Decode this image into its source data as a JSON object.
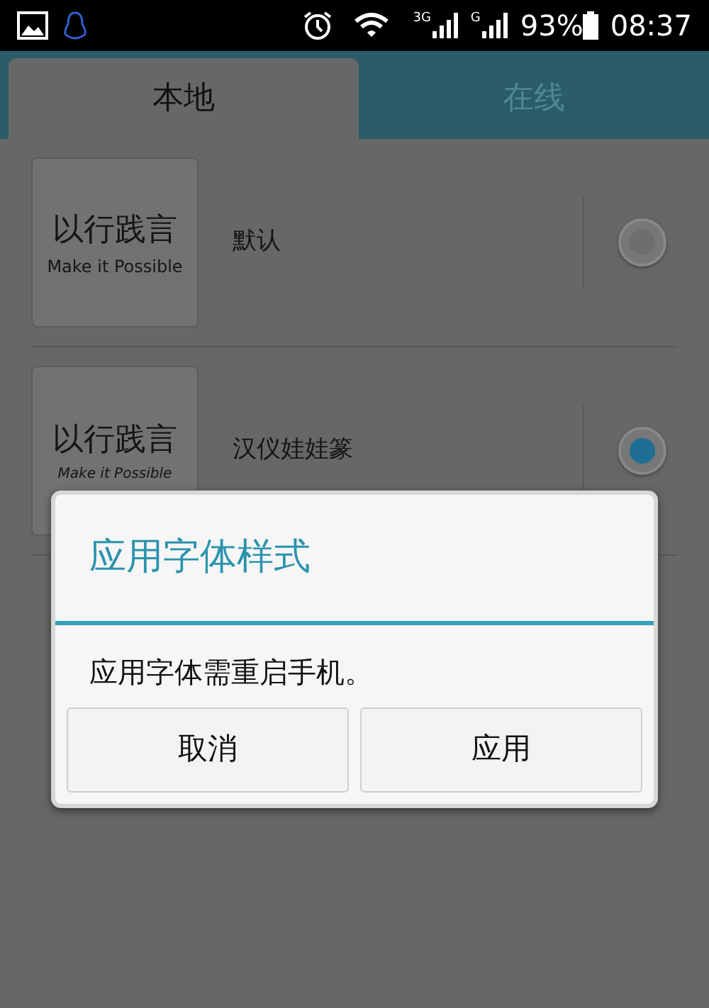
{
  "status_bar": {
    "network_3g": "3G",
    "network_g": "G",
    "battery": "93%",
    "time": "08:37"
  },
  "tabs": [
    {
      "label": "本地",
      "selected": true
    },
    {
      "label": "在线",
      "selected": false
    }
  ],
  "fonts": [
    {
      "preview_title": "以行践言",
      "preview_subtitle": "Make it Possible",
      "name": "默认",
      "selected": false,
      "kind": "plain"
    },
    {
      "preview_title": "以行践言",
      "preview_subtitle": "Make it Possible",
      "name": "汉仪娃娃篆",
      "selected": true,
      "kind": "handwritten"
    }
  ],
  "dialog": {
    "title": "应用字体样式",
    "message": "应用字体需重启手机。",
    "buttons": [
      "取消",
      "应用"
    ]
  }
}
